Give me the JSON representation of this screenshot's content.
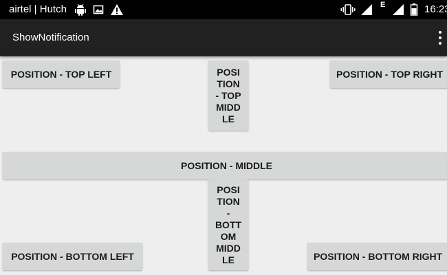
{
  "status_bar": {
    "carrier": "airtel | Hutch",
    "network_type": "E",
    "time": "16:23",
    "icons": [
      "android-icon",
      "image-icon",
      "warning-icon",
      "vibrate-icon",
      "signal-icon",
      "signal-icon",
      "battery-icon"
    ]
  },
  "toolbar": {
    "title": "ShowNotification",
    "menu_icon": "overflow-menu-icon"
  },
  "buttons": {
    "top_left": "POSITION - TOP LEFT",
    "top_middle": "POSI\nTION\n- TOP\nMIDD\nLE",
    "top_right": "POSITION - TOP RIGHT",
    "middle": "POSITION - MIDDLE",
    "bottom_middle": "POSI\nTION\n-\nBOTT\nOM\nMIDD\nLE",
    "bottom_left": "POSITION - BOTTOM LEFT",
    "bottom_right": "POSITION - BOTTOM RIGHT"
  },
  "colors": {
    "status_bar": "#000000",
    "toolbar": "#212121",
    "background": "#eeeeee",
    "button": "#d6d7d7"
  }
}
